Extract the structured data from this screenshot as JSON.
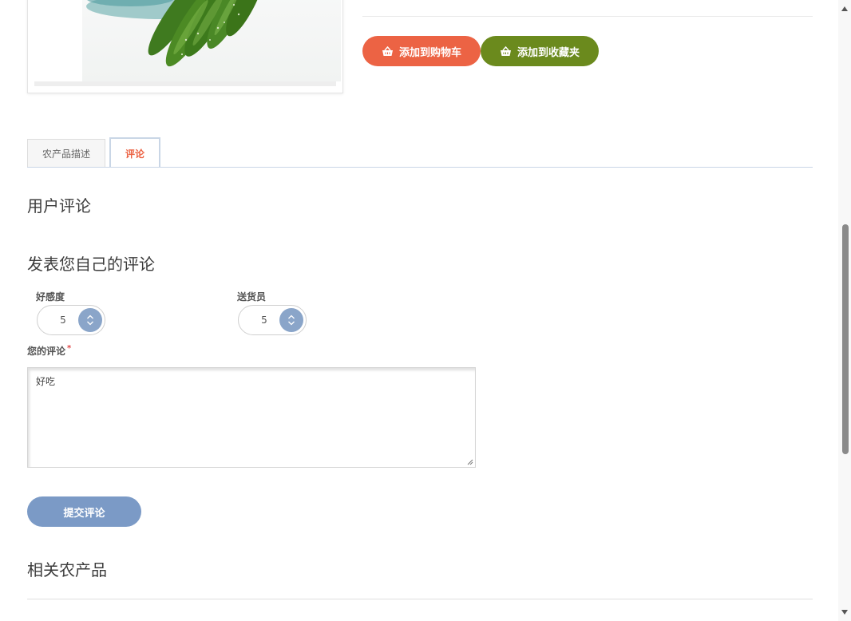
{
  "product": {
    "image_alt": "cucumbers",
    "add_to_cart_label": "添加到购物车",
    "add_to_favorites_label": "添加到收藏夹"
  },
  "tabs": [
    {
      "label": "农产品描述",
      "active": false
    },
    {
      "label": "评论",
      "active": true
    }
  ],
  "reviews": {
    "title": "用户评论"
  },
  "review_form": {
    "title": "发表您自己的评论",
    "rating_label": "好感度",
    "rating_value": "5",
    "delivery_label": "送货员",
    "delivery_value": "5",
    "comment_label": "您的评论",
    "required_mark": "*",
    "comment_value": "好吃",
    "submit_label": "提交评论"
  },
  "related": {
    "title": "相关农产品"
  },
  "colors": {
    "cart_button": "#ec6344",
    "favorites_button": "#6b8a1d",
    "submit_button": "#7b9ac6",
    "active_tab_text": "#ec6344"
  }
}
